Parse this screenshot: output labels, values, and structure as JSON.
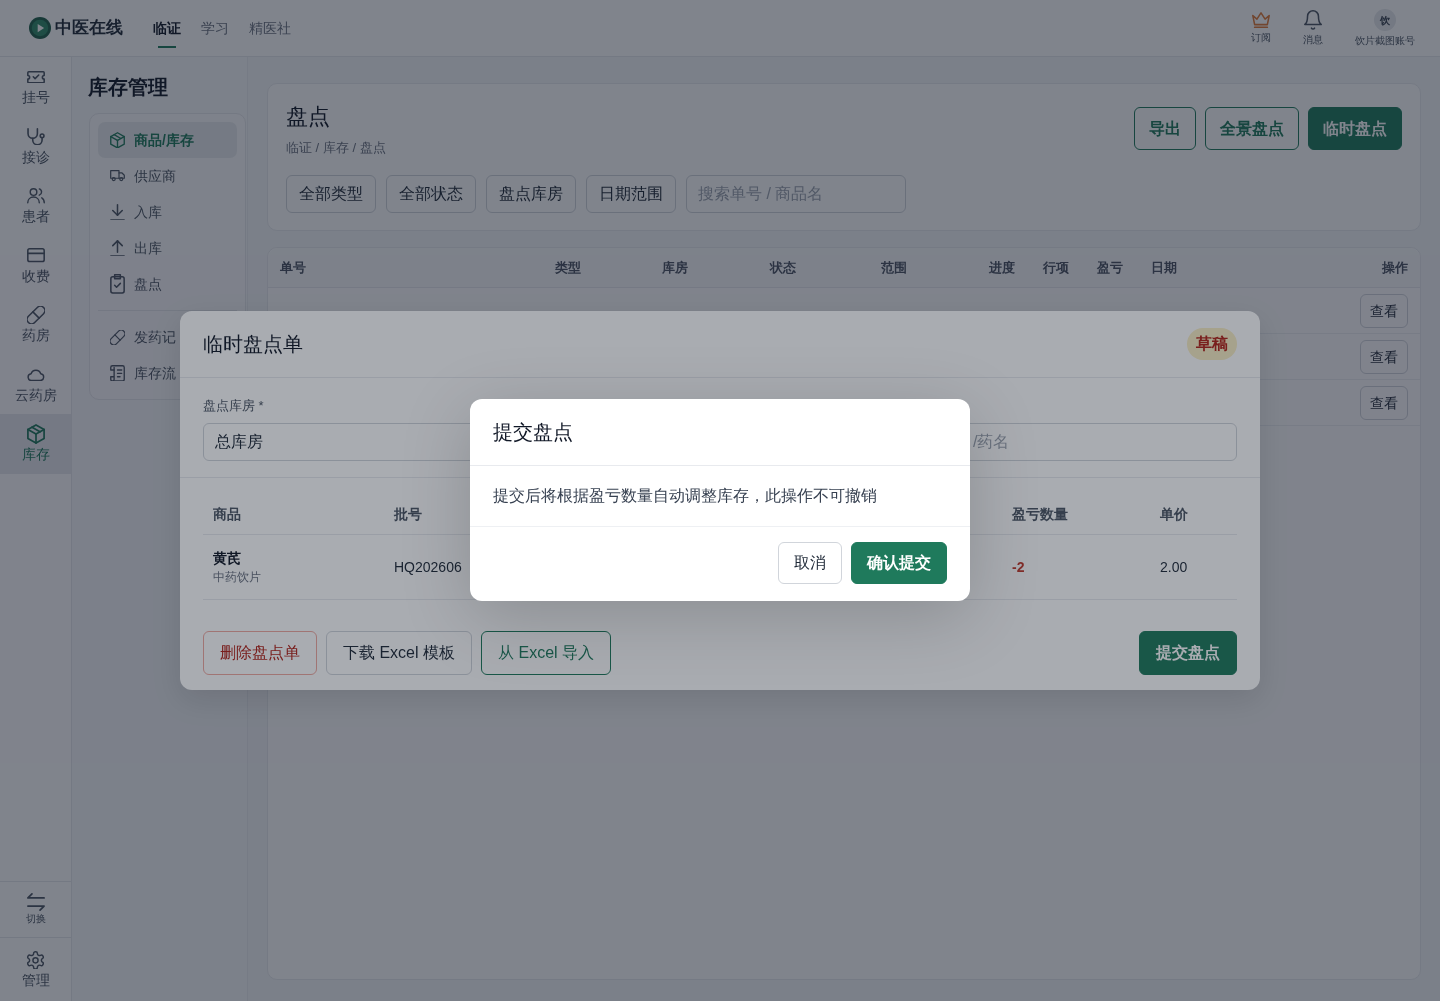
{
  "top_bar": {
    "logo": "中医在线",
    "nav": [
      {
        "label": "临证",
        "selected": true
      },
      {
        "label": "学习",
        "selected": false
      },
      {
        "label": "精医社",
        "selected": false
      }
    ],
    "actions": [
      {
        "label": "订阅"
      },
      {
        "label": "消息"
      }
    ],
    "account": {
      "avatar": "饮",
      "label": "饮片截图账号"
    }
  },
  "rail": {
    "items": [
      {
        "label": "挂号",
        "selected": false
      },
      {
        "label": "接诊",
        "selected": false
      },
      {
        "label": "患者",
        "selected": false
      },
      {
        "label": "收费",
        "selected": false
      },
      {
        "label": "药房",
        "selected": false
      },
      {
        "label": "云药房",
        "selected": false
      },
      {
        "label": "库存",
        "selected": true
      }
    ],
    "footer_items": [
      {
        "label": "切换"
      },
      {
        "label": "管理"
      }
    ]
  },
  "sub_nav": {
    "title": "库存管理",
    "sections": [
      {
        "items": [
          {
            "label": "商品/库存",
            "selected": true
          },
          {
            "label": "供应商",
            "selected": false
          },
          {
            "label": "入库",
            "selected": false
          },
          {
            "label": "出库",
            "selected": false
          },
          {
            "label": "盘点",
            "selected": false
          }
        ]
      },
      {
        "items": [
          {
            "label": "发药记",
            "selected": false
          },
          {
            "label": "库存流",
            "selected": false
          }
        ]
      }
    ]
  },
  "page_header": {
    "title": "盘点",
    "breadcrumb": "临证 / 库存 / 盘点",
    "buttons": [
      {
        "label": "导出",
        "kind": "outline"
      },
      {
        "label": "全景盘点",
        "kind": "outline"
      },
      {
        "label": "临时盘点",
        "kind": "primary"
      }
    ],
    "filters": [
      "全部类型",
      "全部状态",
      "盘点库房",
      "日期范围"
    ],
    "search": {
      "placeholder": "搜索单号 / 商品名"
    }
  },
  "table": {
    "columns": [
      "单号",
      "类型",
      "库房",
      "状态",
      "范围",
      "进度",
      "行项",
      "盈亏",
      "日期",
      "操作"
    ],
    "rows": [
      {
        "action": "查看"
      },
      {
        "action": "查看"
      },
      {
        "action": "查看"
      }
    ]
  },
  "stocktake_modal": {
    "title": "临时盘点单",
    "status": "草稿",
    "warehouse": {
      "label": "盘点库房 *",
      "value": "总库房"
    },
    "search": {
      "placeholder": "/药名"
    },
    "columns": [
      "商品",
      "批号",
      "盈亏数量",
      "单价"
    ],
    "rows": [
      {
        "name": "黄芪",
        "category": "中药饮片",
        "batch": "HQ202606",
        "diff": "-2",
        "price": "2.00"
      }
    ],
    "buttons": [
      {
        "label": "删除盘点单",
        "kind": "danger"
      },
      {
        "label": "下载 Excel 模板",
        "kind": "default"
      },
      {
        "label": "从 Excel 导入",
        "kind": "success-outline"
      },
      {
        "label": "提交盘点",
        "kind": "primary"
      }
    ]
  },
  "confirm_dialog": {
    "title": "提交盘点",
    "message": "提交后将根据盈亏数量自动调整库存，此操作不可撤销",
    "buttons": [
      {
        "label": "取消",
        "kind": "default"
      },
      {
        "label": "确认提交",
        "kind": "primary"
      }
    ]
  }
}
